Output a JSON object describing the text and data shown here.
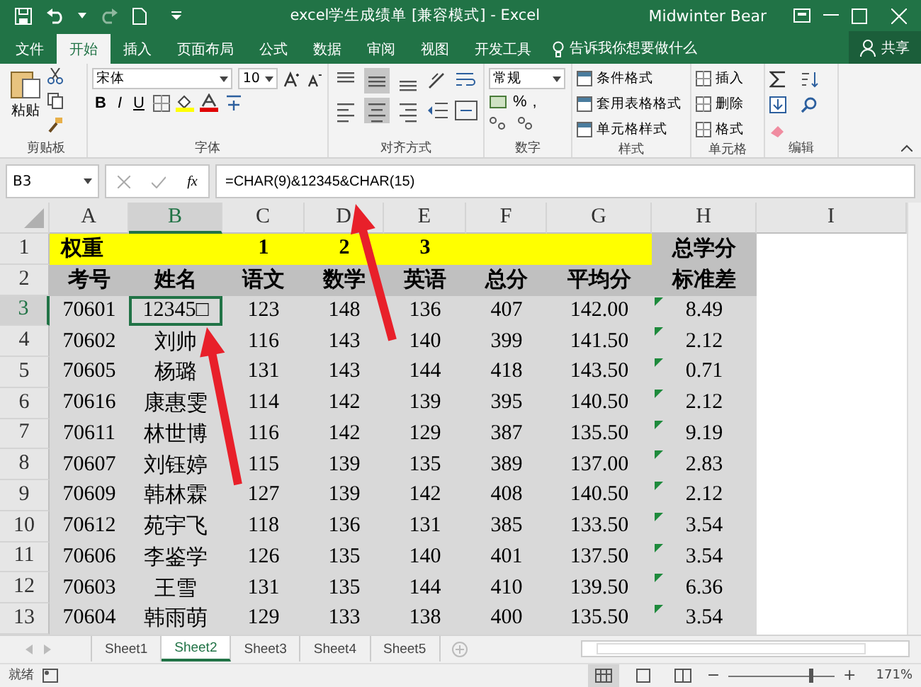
{
  "title_bar": {
    "title": "excel学生成绩单  [兼容模式]  -  Excel",
    "user": "Midwinter Bear"
  },
  "menu_tabs": [
    {
      "label": "文件",
      "selected": false
    },
    {
      "label": "开始",
      "selected": true
    },
    {
      "label": "插入",
      "selected": false
    },
    {
      "label": "页面布局",
      "selected": false
    },
    {
      "label": "公式",
      "selected": false
    },
    {
      "label": "数据",
      "selected": false
    },
    {
      "label": "审阅",
      "selected": false
    },
    {
      "label": "视图",
      "selected": false
    },
    {
      "label": "开发工具",
      "selected": false
    }
  ],
  "tell_me": {
    "placeholder": "告诉我你想要做什么"
  },
  "share": "共享",
  "ribbon": {
    "clipboard": {
      "paste": "粘贴",
      "label": "剪贴板"
    },
    "font": {
      "name": "宋体",
      "size": "10",
      "bold": "B",
      "italic": "I",
      "underline": "U",
      "label": "字体"
    },
    "alignment": {
      "label": "对齐方式",
      "top_row": [
        {
          "kind": "top",
          "selected": false
        },
        {
          "kind": "middle",
          "selected": true
        },
        {
          "kind": "bottom",
          "selected": false
        }
      ],
      "bottom_row": [
        {
          "kind": "left",
          "selected": false
        },
        {
          "kind": "center",
          "selected": true
        },
        {
          "kind": "right",
          "selected": false
        }
      ]
    },
    "number": {
      "format": "常规",
      "percent": "%",
      "comma": ",",
      "label": "数字"
    },
    "styles": {
      "items": [
        "条件格式",
        "套用表格格式",
        "单元格样式"
      ],
      "label": "样式"
    },
    "cells": {
      "items": [
        "插入",
        "删除",
        "格式"
      ],
      "label": "单元格"
    },
    "editing": {
      "label": "编辑"
    }
  },
  "formula_bar": {
    "name_box": "B3",
    "fx": "fx",
    "formula": "=CHAR(9)&12345&CHAR(15)"
  },
  "columns": [
    {
      "label": "A",
      "selected": false
    },
    {
      "label": "B",
      "selected": true
    },
    {
      "label": "C",
      "selected": false
    },
    {
      "label": "D",
      "selected": false
    },
    {
      "label": "E",
      "selected": false
    },
    {
      "label": "F",
      "selected": false
    },
    {
      "label": "G",
      "selected": false
    },
    {
      "label": "H",
      "selected": false
    },
    {
      "label": "I",
      "selected": false
    }
  ],
  "rows": [
    {
      "number": "1",
      "kind": "weights",
      "selected": false,
      "error_marker": false,
      "cells": [
        "权重",
        null,
        "1",
        "2",
        "3",
        null,
        null,
        "总学分"
      ]
    },
    {
      "number": "2",
      "kind": "header",
      "selected": false,
      "error_marker": false,
      "cells": [
        "考号",
        "姓名",
        "语文",
        "数学",
        "英语",
        "总分",
        "平均分",
        "标准差"
      ]
    },
    {
      "number": "3",
      "kind": "data",
      "selected": true,
      "error_marker": true,
      "cells": [
        "70601",
        "12345□",
        "123",
        "148",
        "136",
        "407",
        "142.00",
        "8.49"
      ]
    },
    {
      "number": "4",
      "kind": "data",
      "selected": false,
      "error_marker": true,
      "cells": [
        "70602",
        "刘帅",
        "116",
        "143",
        "140",
        "399",
        "141.50",
        "2.12"
      ]
    },
    {
      "number": "5",
      "kind": "data",
      "selected": false,
      "error_marker": true,
      "cells": [
        "70605",
        "杨璐",
        "131",
        "143",
        "144",
        "418",
        "143.50",
        "0.71"
      ]
    },
    {
      "number": "6",
      "kind": "data",
      "selected": false,
      "error_marker": true,
      "cells": [
        "70616",
        "康惠雯",
        "114",
        "142",
        "139",
        "395",
        "140.50",
        "2.12"
      ]
    },
    {
      "number": "7",
      "kind": "data",
      "selected": false,
      "error_marker": true,
      "cells": [
        "70611",
        "林世博",
        "116",
        "142",
        "129",
        "387",
        "135.50",
        "9.19"
      ]
    },
    {
      "number": "8",
      "kind": "data",
      "selected": false,
      "error_marker": true,
      "cells": [
        "70607",
        "刘钰婷",
        "115",
        "139",
        "135",
        "389",
        "137.00",
        "2.83"
      ]
    },
    {
      "number": "9",
      "kind": "data",
      "selected": false,
      "error_marker": true,
      "cells": [
        "70609",
        "韩林霖",
        "127",
        "139",
        "142",
        "408",
        "140.50",
        "2.12"
      ]
    },
    {
      "number": "10",
      "kind": "data",
      "selected": false,
      "error_marker": true,
      "cells": [
        "70612",
        "苑宇飞",
        "118",
        "136",
        "131",
        "385",
        "133.50",
        "3.54"
      ]
    },
    {
      "number": "11",
      "kind": "data",
      "selected": false,
      "error_marker": true,
      "cells": [
        "70606",
        "李鉴学",
        "126",
        "135",
        "140",
        "401",
        "137.50",
        "3.54"
      ]
    },
    {
      "number": "12",
      "kind": "data",
      "selected": false,
      "error_marker": true,
      "cells": [
        "70603",
        "王雪",
        "131",
        "135",
        "144",
        "410",
        "139.50",
        "6.36"
      ]
    },
    {
      "number": "13",
      "kind": "data",
      "selected": false,
      "error_marker": true,
      "cells": [
        "70604",
        "韩雨萌",
        "129",
        "133",
        "138",
        "400",
        "135.50",
        "3.54"
      ]
    }
  ],
  "sheets": [
    {
      "label": "Sheet1",
      "selected": false
    },
    {
      "label": "Sheet2",
      "selected": true
    },
    {
      "label": "Sheet3",
      "selected": false
    },
    {
      "label": "Sheet4",
      "selected": false
    },
    {
      "label": "Sheet5",
      "selected": false
    }
  ],
  "status_bar": {
    "status": "就绪",
    "zoom_out": "−",
    "zoom_slider": {
      "level": 0.78
    },
    "zoom_in": "+",
    "zoom": "171%"
  }
}
